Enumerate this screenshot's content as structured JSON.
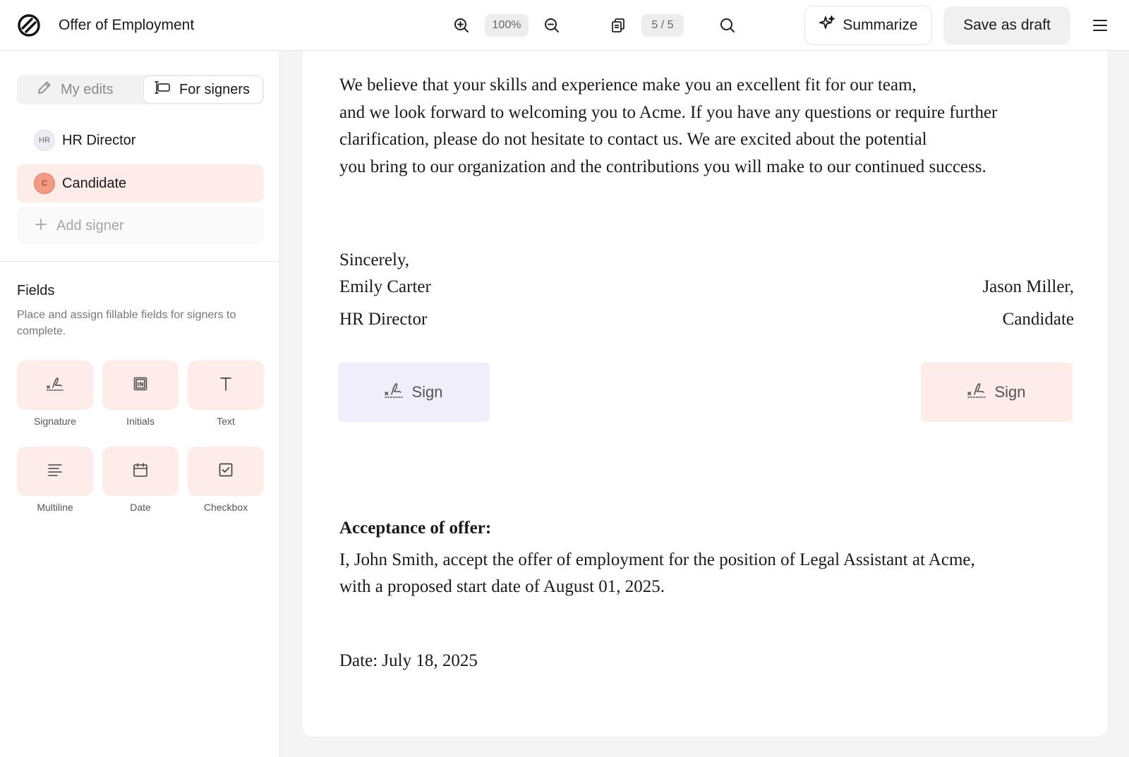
{
  "header": {
    "title": "Offer of Employment",
    "zoom": "100%",
    "page_indicator": "5 / 5",
    "summarize_label": "Summarize",
    "save_draft_label": "Save as draft"
  },
  "sidebar": {
    "segments": {
      "my_edits": "My edits",
      "for_signers": "For signers",
      "active": "for_signers"
    },
    "signers": [
      {
        "initials": "HR",
        "name": "HR Director"
      },
      {
        "initials": "C",
        "name": "Candidate",
        "selected": true
      }
    ],
    "add_signer_label": "Add signer",
    "fields": {
      "title": "Fields",
      "description": "Place and assign fillable fields for signers to complete.",
      "items": [
        {
          "label": "Signature",
          "icon": "signature-icon"
        },
        {
          "label": "Initials",
          "icon": "initials-icon"
        },
        {
          "label": "Text",
          "icon": "text-icon"
        },
        {
          "label": "Multiline",
          "icon": "multiline-icon"
        },
        {
          "label": "Date",
          "icon": "calendar-icon"
        },
        {
          "label": "Checkbox",
          "icon": "checkbox-icon"
        }
      ]
    }
  },
  "document": {
    "paragraph_lines": [
      "We believe that your skills and experience make you an excellent fit for our team,",
      "and we look forward to welcoming you to Acme. If you have any questions or require further",
      "clarification, please do not hesitate to contact us. We are excited about the potential",
      "you bring to our organization and the contributions you will make to our continued success."
    ],
    "closing": "Sincerely,",
    "sender_name": "Emily Carter",
    "sender_title": "HR Director",
    "recipient_name": "Jason Miller,",
    "recipient_title": "Candidate",
    "sign_label": "Sign",
    "acceptance_heading": "Acceptance of offer:",
    "acceptance_lines": [
      "I, John Smith, accept the offer of employment for the position of Legal Assistant at Acme,",
      "with a proposed start date of August 01, 2025."
    ],
    "date_line": "Date: July 18, 2025"
  },
  "colors": {
    "candidate_accent": "#fdece7",
    "hr_accent": "#f1eefc",
    "candidate_avatar": "#f39a82"
  }
}
